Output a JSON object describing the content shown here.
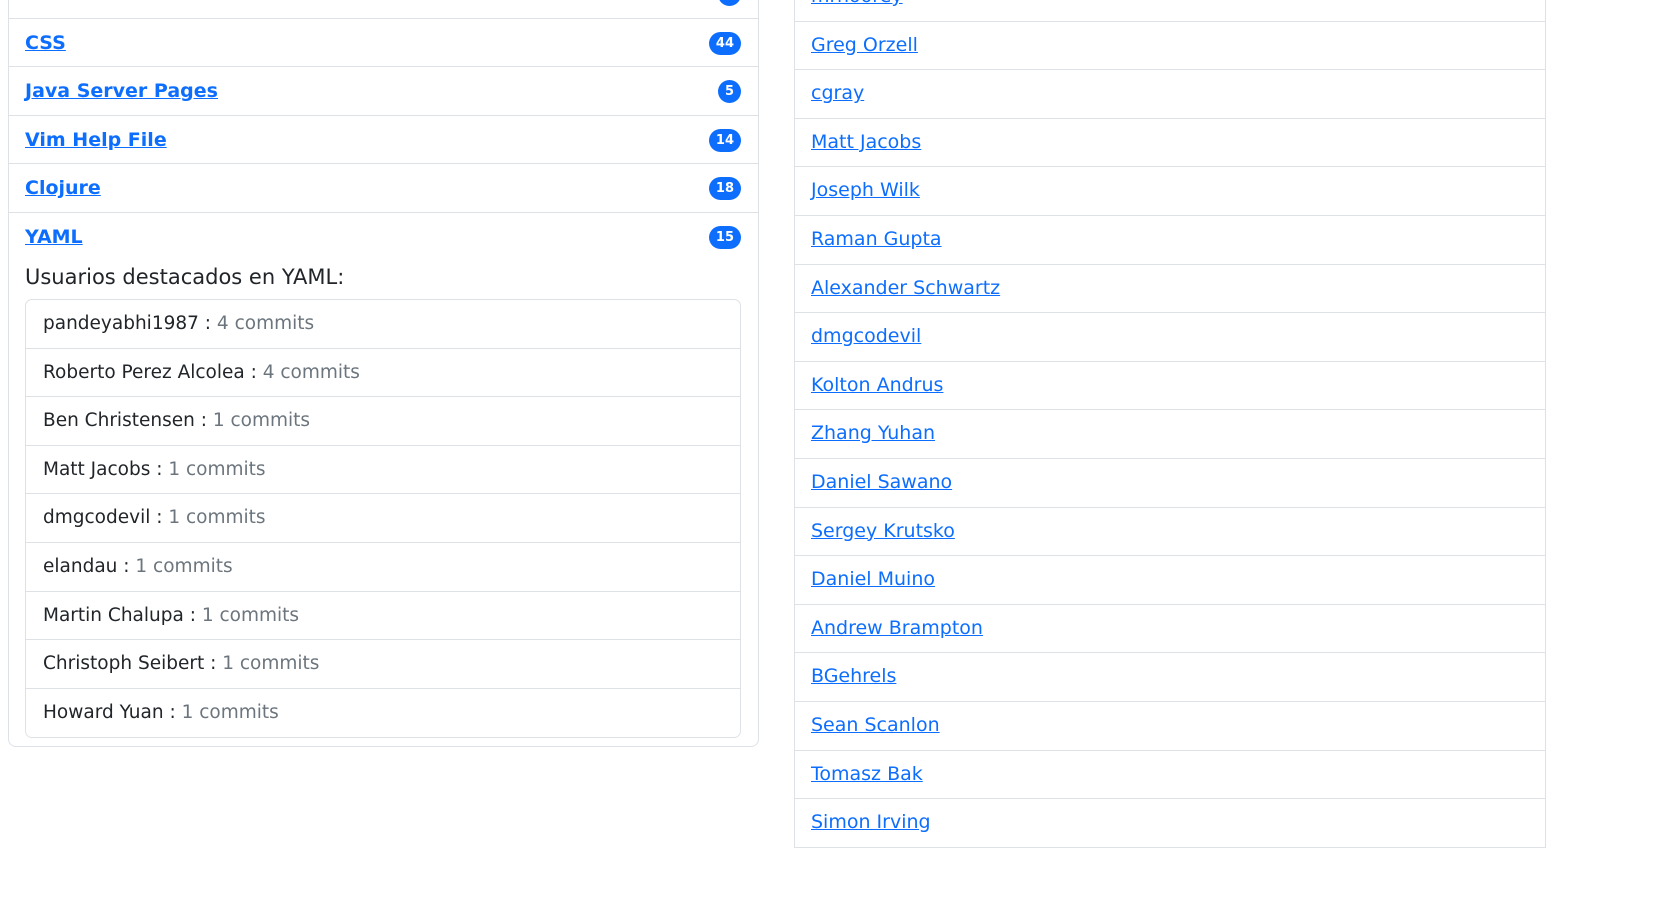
{
  "languages": [
    {
      "name": "",
      "count": ""
    },
    {
      "name": "CSS",
      "count": "44"
    },
    {
      "name": "Java Server Pages",
      "count": "5"
    },
    {
      "name": "Vim Help File",
      "count": "14"
    },
    {
      "name": "Clojure",
      "count": "18"
    },
    {
      "name": "YAML",
      "count": "15"
    }
  ],
  "yaml_section": {
    "title": "Usuarios destacados en YAML:",
    "users": [
      {
        "name": "pandeyabhi1987 :",
        "commits": "4 commits"
      },
      {
        "name": "Roberto Perez Alcolea :",
        "commits": "4 commits"
      },
      {
        "name": "Ben Christensen :",
        "commits": "1 commits"
      },
      {
        "name": "Matt Jacobs :",
        "commits": "1 commits"
      },
      {
        "name": "dmgcodevil :",
        "commits": "1 commits"
      },
      {
        "name": "elandau :",
        "commits": "1 commits"
      },
      {
        "name": "Martin Chalupa :",
        "commits": "1 commits"
      },
      {
        "name": "Christoph Seibert :",
        "commits": "1 commits"
      },
      {
        "name": "Howard Yuan :",
        "commits": "1 commits"
      }
    ]
  },
  "contributors": [
    "mrnoorey",
    "Greg Orzell",
    "cgray",
    "Matt Jacobs",
    "Joseph Wilk",
    "Raman Gupta",
    "Alexander Schwartz",
    "dmgcodevil",
    "Kolton Andrus",
    "Zhang Yuhan",
    "Daniel Sawano",
    "Sergey Krutsko",
    "Daniel Muino",
    "Andrew Brampton",
    "BGehrels",
    "Sean Scanlon",
    "Tomasz Bak",
    "Simon Irving"
  ],
  "colors": {
    "link": "#0d6efd",
    "badge_bg": "#0d6efd",
    "border": "#dee2e6",
    "muted_text": "#6c757d",
    "body_text": "#212529"
  }
}
